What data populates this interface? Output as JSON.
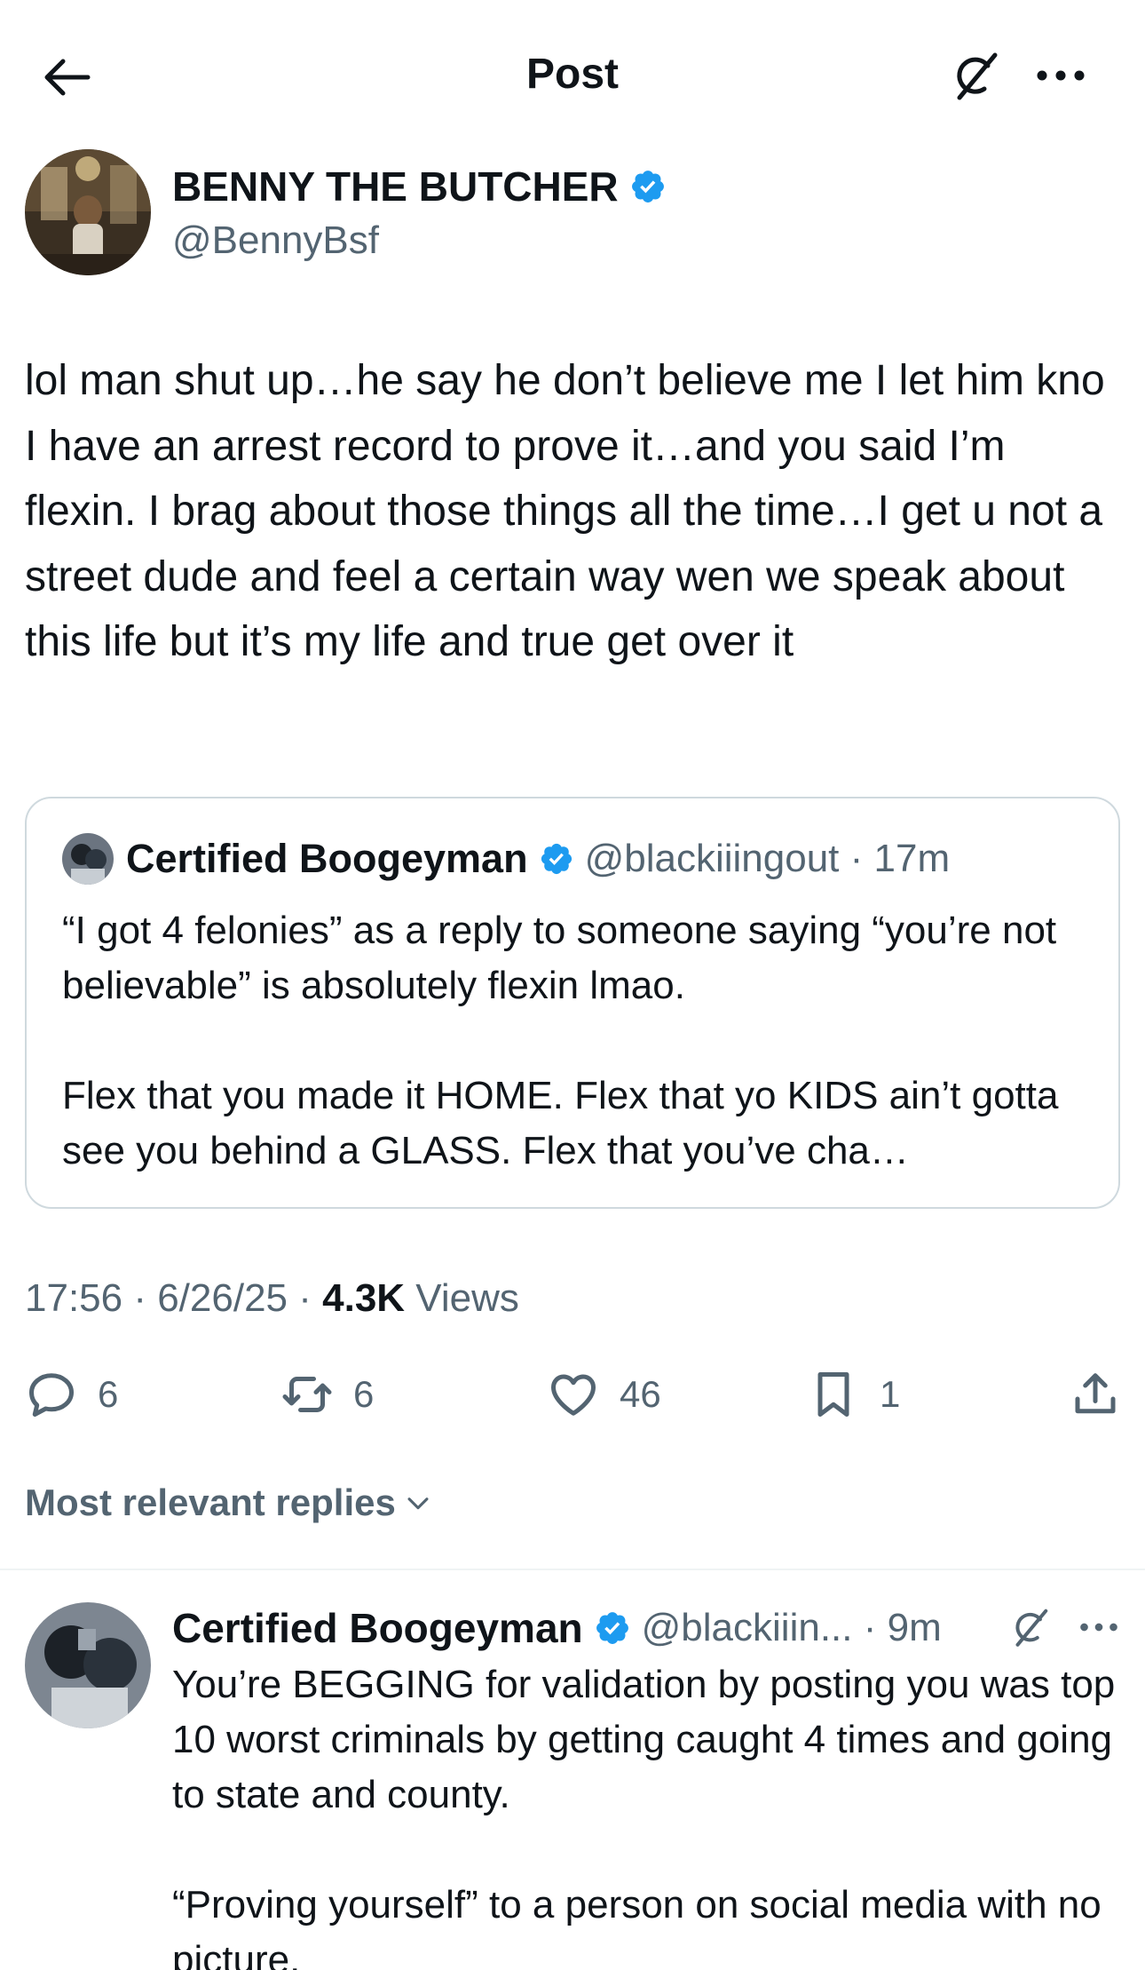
{
  "header": {
    "title": "Post",
    "back_icon": "arrow-left-icon",
    "grok_icon": "grok-icon",
    "more_icon": "more-horizontal-icon"
  },
  "post": {
    "author_name": "BENNY THE BUTCHER",
    "author_handle": "@BennyBsf",
    "text": "lol man shut up…he say he don’t believe me I let him kno I have an arrest record to prove it…and you said I’m flexin. I brag about those things all the time…I get u not a street dude and feel a certain way wen we speak about this life but it’s my life and true get over it",
    "timestamp": "17:56 · 6/26/25 · ",
    "views_count": "4.3K",
    "views_label": " Views",
    "verified_color": "#1d9bf0"
  },
  "quote": {
    "author_name": "Certified Boogeyman",
    "author_handle": "@blackiiingout · 17m",
    "paragraph1": "“I got 4 felonies” as a reply to someone saying “you’re not believable” is absolutely flexin lmao.",
    "paragraph2": "Flex that you made it HOME. Flex that yo KIDS ain’t gotta see you behind a GLASS. Flex that you’ve cha…"
  },
  "actions": {
    "replies": "6",
    "reposts": "6",
    "likes": "46",
    "bookmarks": "1",
    "icons": [
      "reply-icon",
      "repost-icon",
      "like-icon",
      "bookmark-icon",
      "share-icon"
    ]
  },
  "sort": {
    "label": "Most relevant replies"
  },
  "reply": {
    "author_name": "Certified Boogeyman",
    "author_handle": "@blackiiin... · 9m",
    "paragraph1": "You’re BEGGING for validation by posting you was top 10 worst criminals by getting caught 4 times and going to state and county.",
    "paragraph2": "“Proving yourself” to a person on social media with no picture."
  }
}
